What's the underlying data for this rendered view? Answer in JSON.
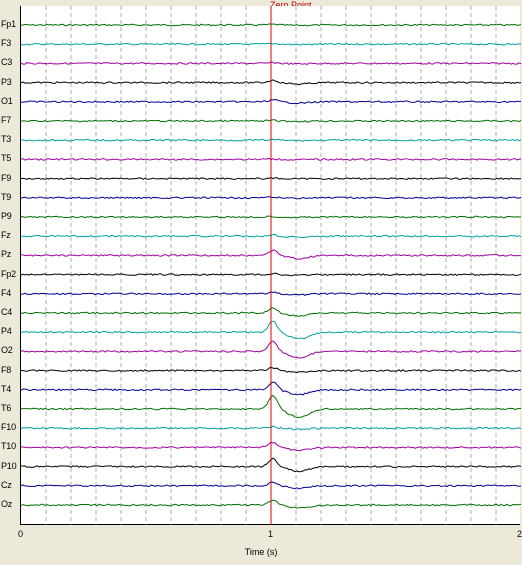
{
  "zero_point_label": "Zero Point",
  "x_axis_label": "Time (s)",
  "x_tick_labels": [
    "0",
    "1",
    "2"
  ],
  "colors": {
    "background": "#ece9d8",
    "plot_background": "#ffffff",
    "marker": "#e00000",
    "grid": "#777777"
  },
  "channels": [
    {
      "label": "Fp1",
      "color": "#007000",
      "amp": 0.6
    },
    {
      "label": "F3",
      "color": "#00a0a0",
      "amp": 0.6
    },
    {
      "label": "C3",
      "color": "#a000a0",
      "amp": 0.8
    },
    {
      "label": "P3",
      "color": "#000000",
      "amp": 2.5
    },
    {
      "label": "O1",
      "color": "#000090",
      "amp": 2.0
    },
    {
      "label": "F7",
      "color": "#007000",
      "amp": 0.6
    },
    {
      "label": "T3",
      "color": "#00a0a0",
      "amp": 0.6
    },
    {
      "label": "T5",
      "color": "#a000a0",
      "amp": 0.5
    },
    {
      "label": "F9",
      "color": "#000000",
      "amp": 0.5
    },
    {
      "label": "T9",
      "color": "#000090",
      "amp": 0.5
    },
    {
      "label": "P9",
      "color": "#007000",
      "amp": 0.6
    },
    {
      "label": "Fz",
      "color": "#00a0a0",
      "amp": 1.5
    },
    {
      "label": "Pz",
      "color": "#a000a0",
      "amp": 5.0
    },
    {
      "label": "Fp2",
      "color": "#000000",
      "amp": 1.2
    },
    {
      "label": "F4",
      "color": "#000090",
      "amp": 2.0
    },
    {
      "label": "C4",
      "color": "#007000",
      "amp": 5.0
    },
    {
      "label": "P4",
      "color": "#00a0a0",
      "amp": 11.0
    },
    {
      "label": "O2",
      "color": "#a000a0",
      "amp": 10.0
    },
    {
      "label": "F8",
      "color": "#000000",
      "amp": 3.0
    },
    {
      "label": "T4",
      "color": "#000090",
      "amp": 8.0
    },
    {
      "label": "T6",
      "color": "#007000",
      "amp": 14.0
    },
    {
      "label": "F10",
      "color": "#00a0a0",
      "amp": 1.5
    },
    {
      "label": "T10",
      "color": "#a000a0",
      "amp": 5.0
    },
    {
      "label": "P10",
      "color": "#000000",
      "amp": 8.0
    },
    {
      "label": "Cz",
      "color": "#000090",
      "amp": 4.0
    },
    {
      "label": "Oz",
      "color": "#007000",
      "amp": 5.0
    }
  ]
}
